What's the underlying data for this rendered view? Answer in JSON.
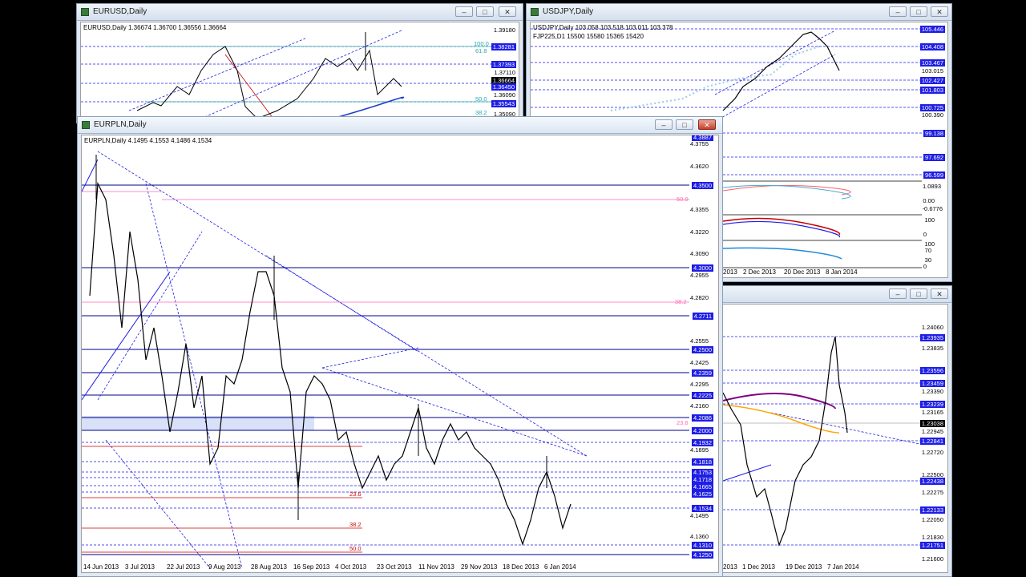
{
  "windows": {
    "eurusd": {
      "title": "EURUSD,Daily",
      "header": "EURUSD,Daily  1.36674 1.36700 1.36556 1.36664",
      "price_labels": [
        "1.39180",
        "1.37110",
        "1.36090",
        "1.35090"
      ],
      "tags": [
        "1.38281",
        "1.37393",
        "1.36664",
        "1.36450",
        "1.35543"
      ],
      "fib": [
        "100.0",
        "61.8",
        "50.0",
        "38.2"
      ]
    },
    "usdjpy": {
      "title": "USDJPY,Daily",
      "header": "USDJPY,Daily  103.058 103.518 103.011 103.378",
      "indicator": "FJP225,D1  15500 15580 15365 15420",
      "tags": [
        "105.446",
        "104.408",
        "103.467",
        "102.427",
        "101.803",
        "100.725",
        "99.138",
        "97.692",
        "96.599"
      ],
      "price_labels": [
        "103.015",
        "100.390"
      ],
      "osc1": [
        "1.0893",
        "0.00",
        "-0.6776"
      ],
      "osc2": [
        "100",
        "0"
      ],
      "osc3": [
        "100",
        "70",
        "30",
        "0"
      ],
      "time_labels": [
        "2013",
        "2 Dec 2013",
        "20 Dec 2013",
        "8 Jan 2014"
      ]
    },
    "eurpln": {
      "title": "EURPLN,Daily",
      "header": "EURPLN,Daily  4.1495 4.1553 4.1486 4.1534",
      "price_labels": [
        "4.3755",
        "4.3620",
        "4.3355",
        "4.3220",
        "4.3090",
        "4.2955",
        "4.2820",
        "4.2555",
        "4.2425",
        "4.2295",
        "4.2160",
        "4.1895",
        "4.1495",
        "4.1360"
      ],
      "tags": [
        "4.3887",
        "4.3500",
        "4.3000",
        "4.2711",
        "4.2500",
        "4.2359",
        "4.2225",
        "4.2086",
        "4.2000",
        "4.1932",
        "4.1818",
        "4.1753",
        "4.1718",
        "4.1665",
        "4.1625",
        "4.1534",
        "4.1310",
        "4.1250"
      ],
      "fib": [
        "50.0",
        "38.2",
        "23.6",
        "23.6",
        "38.2",
        "50.0"
      ],
      "time_labels": [
        "14 Jun 2013",
        "3 Jul 2013",
        "22 Jul 2013",
        "9 Aug 2013",
        "28 Aug 2013",
        "16 Sep 2013",
        "4 Oct 2013",
        "23 Oct 2013",
        "11 Nov 2013",
        "29 Nov 2013",
        "18 Dec 2013",
        "6 Jan 2014"
      ]
    },
    "w4": {
      "tags": [
        "1.23935",
        "1.23596",
        "1.23459",
        "1.23239",
        "1.23038",
        "1.22841",
        "1.22438",
        "1.22133",
        "1.21751"
      ],
      "price_labels": [
        "1.24060",
        "1.23835",
        "1.23390",
        "1.23165",
        "1.22945",
        "1.22720",
        "1.22500",
        "1.22275",
        "1.22050",
        "1.21830",
        "1.21600"
      ],
      "time_labels": [
        "2013",
        "1 Dec 2013",
        "19 Dec 2013",
        "7 Jan 2014"
      ]
    }
  },
  "buttons": {
    "min": "–",
    "max": "□",
    "close": "✕"
  },
  "colors": {
    "tag_blue": "#1e1ee6",
    "level_blue": "#00008b",
    "fib_pink": "#ff69b4",
    "fib_red": "#cc0000",
    "ma_orange": "#ffa500",
    "ma_purple": "#800080"
  }
}
